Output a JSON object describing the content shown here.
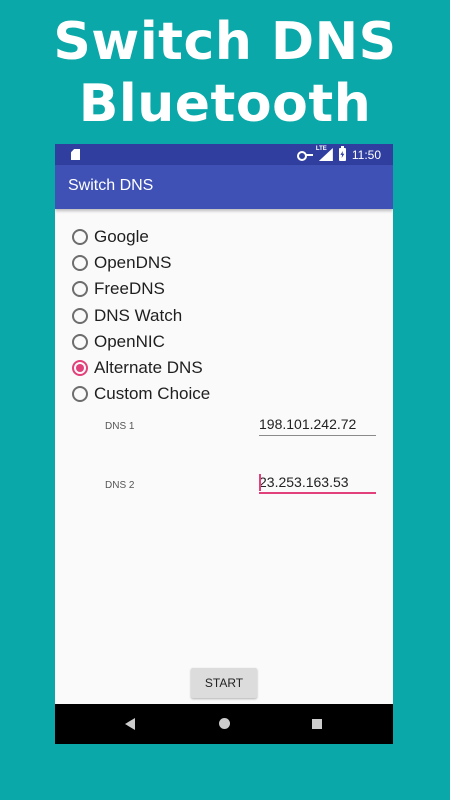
{
  "promo": {
    "line1": "Switch DNS",
    "line2": "Bluetooth"
  },
  "status_bar": {
    "time": "11:50",
    "network": "LTE"
  },
  "app_bar": {
    "title": "Switch DNS"
  },
  "radio_options": [
    {
      "label": "Google",
      "checked": false
    },
    {
      "label": "OpenDNS",
      "checked": false
    },
    {
      "label": "FreeDNS",
      "checked": false
    },
    {
      "label": "DNS Watch",
      "checked": false
    },
    {
      "label": "OpenNIC",
      "checked": false
    },
    {
      "label": "Alternate DNS",
      "checked": true
    },
    {
      "label": "Custom Choice",
      "checked": false
    }
  ],
  "dns1": {
    "label": "DNS 1",
    "value": "198.101.242.72"
  },
  "dns2": {
    "label": "DNS 2",
    "value": "23.253.163.53"
  },
  "start_button": {
    "label": "START"
  },
  "colors": {
    "background": "#0AA8A8",
    "primary": "#3F51B5",
    "primary_dark": "#303F9F",
    "accent": "#E2407A"
  }
}
